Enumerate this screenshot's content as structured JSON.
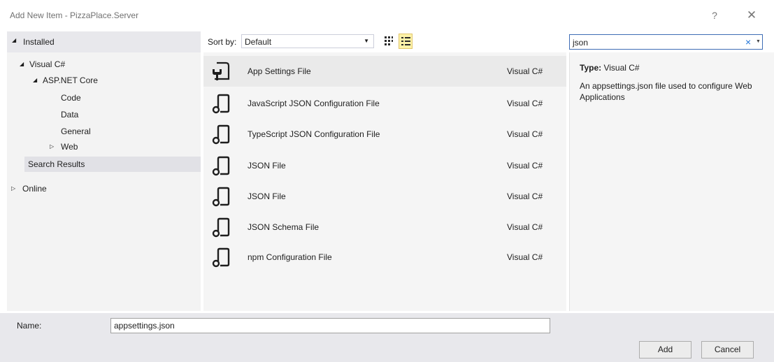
{
  "window": {
    "title": "Add New Item - PizzaPlace.Server",
    "help_glyph": "?",
    "close_glyph": "✕"
  },
  "left_header": {
    "label": "Installed"
  },
  "tree": {
    "items": [
      {
        "label": "Visual C#"
      },
      {
        "label": "ASP.NET Core"
      },
      {
        "label": "Code"
      },
      {
        "label": "Data"
      },
      {
        "label": "General"
      },
      {
        "label": "Web"
      },
      {
        "label": "Search Results"
      }
    ],
    "online": {
      "label": "Online"
    }
  },
  "toolbar": {
    "sort_label": "Sort by:",
    "sort_value": "Default"
  },
  "search": {
    "value": "json",
    "clear_glyph": "×"
  },
  "templates": [
    {
      "name": "App Settings File",
      "lang": "Visual C#",
      "icon": "settings-file-icon"
    },
    {
      "name": "JavaScript JSON Configuration File",
      "lang": "Visual C#",
      "icon": "json-file-icon"
    },
    {
      "name": "TypeScript JSON Configuration File",
      "lang": "Visual C#",
      "icon": "json-file-icon"
    },
    {
      "name": "JSON File",
      "lang": "Visual C#",
      "icon": "json-file-icon"
    },
    {
      "name": "JSON File",
      "lang": "Visual C#",
      "icon": "json-file-icon"
    },
    {
      "name": "JSON Schema File",
      "lang": "Visual C#",
      "icon": "json-file-icon"
    },
    {
      "name": "npm Configuration File",
      "lang": "Visual C#",
      "icon": "json-file-icon"
    }
  ],
  "details": {
    "type_label": "Type:",
    "type_value": "Visual C#",
    "description": "An appsettings.json file used to configure Web Applications"
  },
  "bottom": {
    "name_label": "Name:",
    "name_value": "appsettings.json",
    "add_label": "Add",
    "cancel_label": "Cancel"
  },
  "colors": {
    "accent": "#3e6db5",
    "list_view_active": "#fcf2a9",
    "selected_row": "#eaeaea"
  }
}
